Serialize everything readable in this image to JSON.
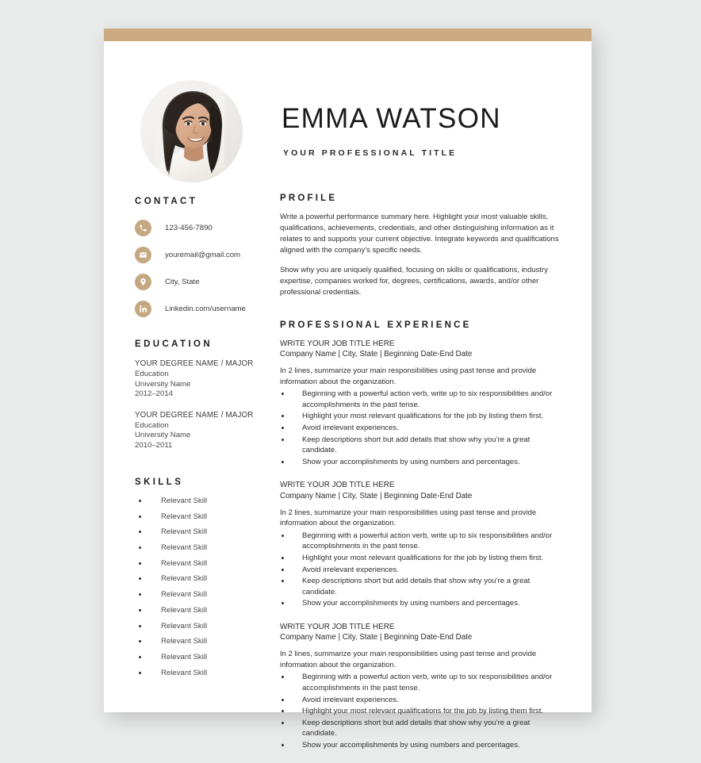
{
  "document": {
    "accent_color": "#cdab82",
    "icon_color": "#c5a781",
    "background_color": "#e9eaea",
    "page_color": "#ffffff"
  },
  "header": {
    "name": "EMMA WATSON",
    "professional_title": "YOUR PROFESSIONAL TITLE",
    "photo_alt": "portrait-photo"
  },
  "contact": {
    "heading": "CONTACT",
    "items": [
      {
        "icon": "phone-icon",
        "value": "123-456-7890"
      },
      {
        "icon": "envelope-icon",
        "value": "youremail@gmail.com"
      },
      {
        "icon": "location-pin-icon",
        "value": "City, State"
      },
      {
        "icon": "linkedin-icon",
        "value": "Linkedin.com/username"
      }
    ]
  },
  "education": {
    "heading": "EDUCATION",
    "entries": [
      {
        "degree": "YOUR DEGREE NAME / MAJOR",
        "field": "Education",
        "school": "University Name",
        "years": "2012–2014"
      },
      {
        "degree": "YOUR DEGREE NAME / MAJOR",
        "field": "Education",
        "school": "University Name",
        "years": "2010–2011"
      }
    ]
  },
  "skills": {
    "heading": "SKILLS",
    "items": [
      "Relevant Skill",
      "Relevant Skill",
      "Relevant Skill",
      "Relevant Skill",
      "Relevant Skill",
      "Relevant Skill",
      "Relevant Skill",
      "Relevant Skill",
      "Relevant Skill",
      "Relevant Skill",
      "Relevant Skill",
      "Relevant Skill"
    ]
  },
  "profile": {
    "heading": "PROFILE",
    "paragraphs": [
      "Write a powerful performance summary here. Highlight your most valuable skills, qualifications, achievements, credentials, and other distinguishing information as it relates to and supports your current objective. Integrate keywords and qualifications aligned with the company’s specific needs.",
      "Show why you are uniquely qualified, focusing on skills or qualifications, industry expertise, companies worked for, degrees, certifications, awards, and/or other professional credentials."
    ]
  },
  "experience": {
    "heading": "PROFESSIONAL EXPERIENCE",
    "jobs": [
      {
        "title": "WRITE YOUR JOB TITLE HERE",
        "meta": "Company Name | City, State | Beginning Date-End Date",
        "summary": "In 2 lines, summarize your main responsibilities using past tense and provide information about the organization.",
        "bullets": [
          "Beginning with a powerful action verb, write up to six responsibilities and/or accomplishments in the past tense.",
          "Highlight your most relevant qualifications for the job by listing them first.",
          "Avoid irrelevant experiences.",
          "Keep descriptions short but add details that show why you’re a great candidate.",
          "Show your accomplishments by using numbers and percentages."
        ]
      },
      {
        "title": "WRITE YOUR JOB TITLE HERE",
        "meta": "Company Name | City, State | Beginning Date-End Date",
        "summary": "In 2 lines, summarize your main responsibilities using past tense and provide information about the organization.",
        "bullets": [
          "Beginning with a powerful action verb, write up to six responsibilities and/or accomplishments in the past tense.",
          "Highlight your most relevant qualifications for the job by listing them first.",
          "Avoid irrelevant experiences.",
          "Keep descriptions short but add details that show why you’re a great candidate.",
          "Show your accomplishments by using numbers and percentages."
        ]
      },
      {
        "title": "WRITE YOUR JOB TITLE HERE",
        "meta": "Company Name | City, State | Beginning Date-End Date",
        "summary": "In 2 lines, summarize your main responsibilities using past tense and provide information about the organization.",
        "bullets": [
          "Beginning with a powerful action verb, write up to six responsibilities and/or accomplishments in the past tense.",
          "Avoid irrelevant experiences.",
          "Highlight your most relevant qualifications for the job by listing them first.",
          "Keep descriptions short but add details that show why you’re a great candidate.",
          "Show your accomplishments by using numbers and percentages."
        ]
      }
    ]
  }
}
